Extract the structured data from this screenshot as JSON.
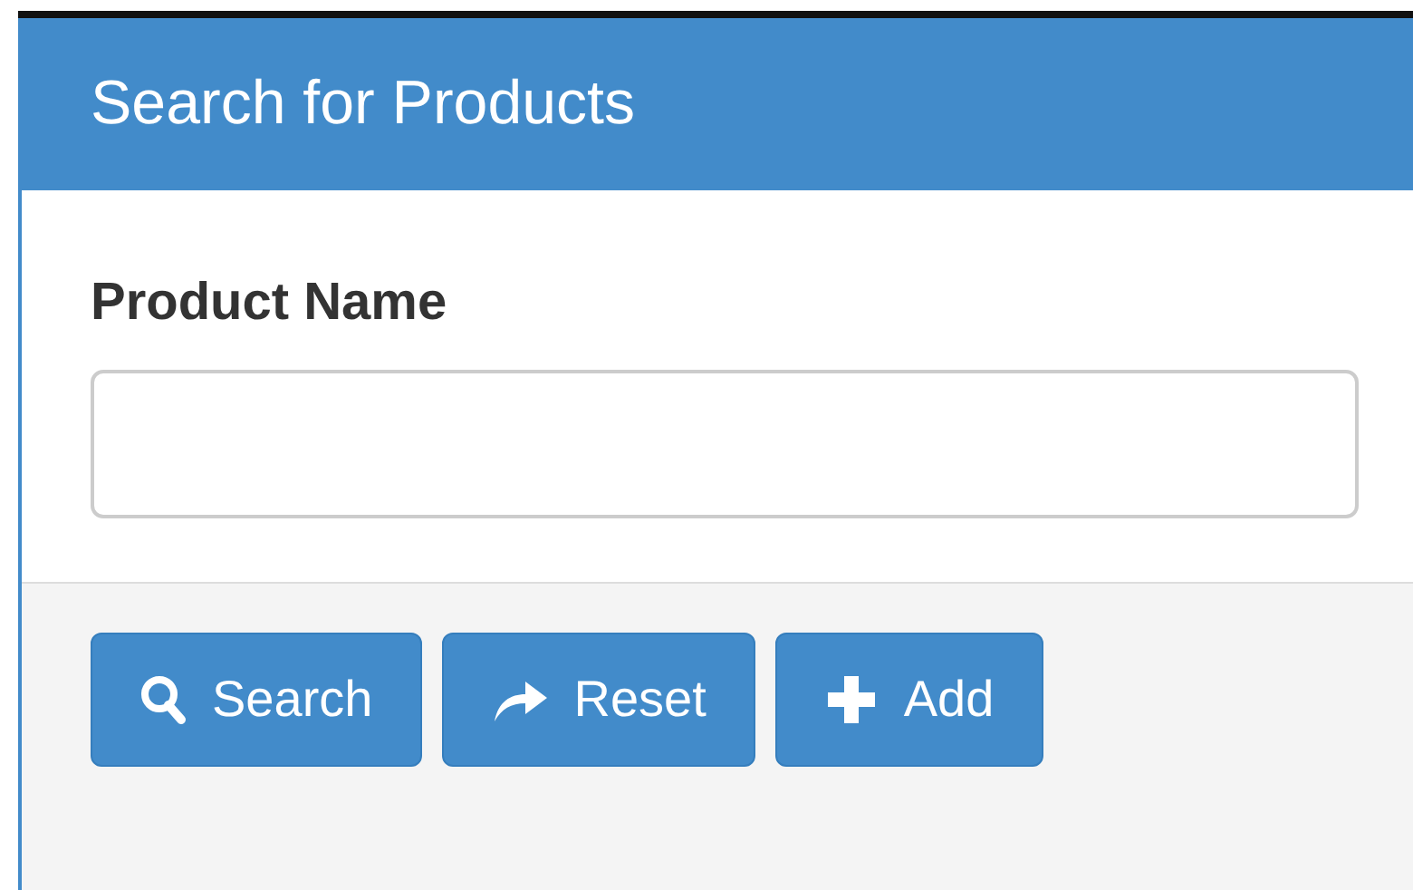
{
  "panel": {
    "title": "Search for Products"
  },
  "field": {
    "label": "Product Name"
  },
  "buttons": [
    {
      "label": "Search",
      "kind": "search"
    },
    {
      "label": "Reset",
      "kind": "reset"
    },
    {
      "label": "Add",
      "kind": "add"
    }
  ]
}
